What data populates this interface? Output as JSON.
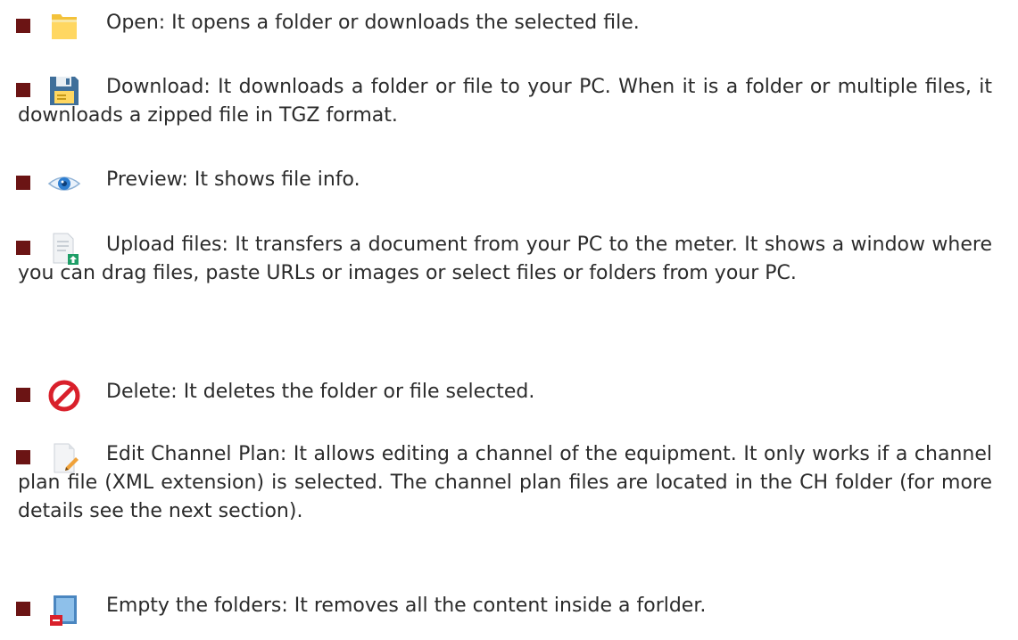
{
  "items": [
    {
      "icon": "folder-icon",
      "text": "Open: It opens a folder or downloads the selected file."
    },
    {
      "icon": "floppy-disk-icon",
      "text": "Download: It downloads a folder or file to your PC. When it is a folder or multiple files, it downloads a zipped file in TGZ format."
    },
    {
      "icon": "eye-icon",
      "text": "Preview: It shows file info."
    },
    {
      "icon": "upload-file-icon",
      "text": "Upload files: It transfers a document from your PC to the meter. It shows a window where you can drag files, paste URLs or images or select files or folders from your PC."
    },
    {
      "icon": "prohibited-icon",
      "text": "Delete: It deletes the folder or file selected."
    },
    {
      "icon": "edit-document-icon",
      "text": "Edit Channel Plan: It allows editing a channel of the equipment. It only works if a channel plan file (XML extension) is selected. The channel plan files are located in the CH folder (for more details see the next section)."
    },
    {
      "icon": "empty-folder-icon",
      "text": "Empty the folders: It removes all the content inside a forlder."
    }
  ],
  "colors": {
    "bullet": "#6b1414",
    "text": "#2b2b2b"
  }
}
